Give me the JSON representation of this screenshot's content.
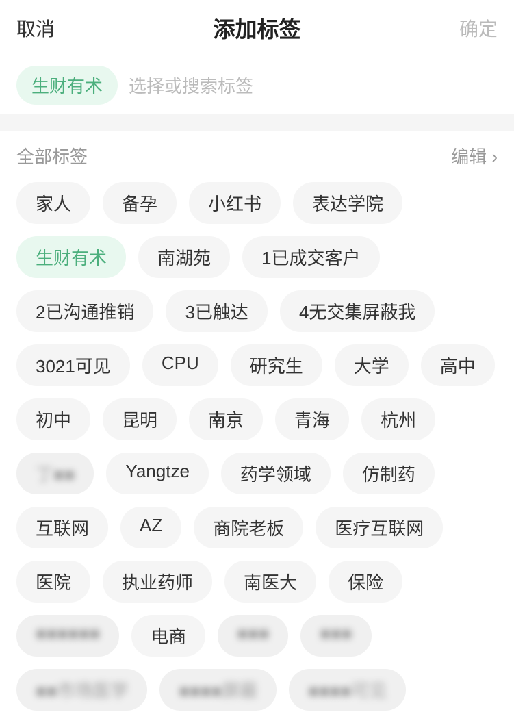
{
  "header": {
    "cancel_label": "取消",
    "title": "添加标签",
    "confirm_label": "确定"
  },
  "search_bar": {
    "selected_tag": "生财有术",
    "placeholder": "选择或搜索标签"
  },
  "all_tags_section": {
    "title": "全部标签",
    "edit_label": "编辑 ›",
    "rows": [
      [
        {
          "text": "家人",
          "active": false,
          "blurred": false
        },
        {
          "text": "备孕",
          "active": false,
          "blurred": false
        },
        {
          "text": "小红书",
          "active": false,
          "blurred": false
        },
        {
          "text": "表达学院",
          "active": false,
          "blurred": false
        }
      ],
      [
        {
          "text": "生财有术",
          "active": true,
          "blurred": false
        },
        {
          "text": "南湖苑",
          "active": false,
          "blurred": false
        },
        {
          "text": "1已成交客户",
          "active": false,
          "blurred": false
        }
      ],
      [
        {
          "text": "2已沟通推销",
          "active": false,
          "blurred": false
        },
        {
          "text": "3已触达",
          "active": false,
          "blurred": false
        },
        {
          "text": "4无交集屏蔽我",
          "active": false,
          "blurred": false
        }
      ],
      [
        {
          "text": "3021可见",
          "active": false,
          "blurred": false
        },
        {
          "text": "CPU",
          "active": false,
          "blurred": false
        },
        {
          "text": "研究生",
          "active": false,
          "blurred": false
        },
        {
          "text": "大学",
          "active": false,
          "blurred": false
        },
        {
          "text": "高中",
          "active": false,
          "blurred": false
        }
      ],
      [
        {
          "text": "初中",
          "active": false,
          "blurred": false
        },
        {
          "text": "昆明",
          "active": false,
          "blurred": false
        },
        {
          "text": "南京",
          "active": false,
          "blurred": false
        },
        {
          "text": "青海",
          "active": false,
          "blurred": false
        },
        {
          "text": "杭州",
          "active": false,
          "blurred": false
        }
      ],
      [
        {
          "text": "丁■■",
          "active": false,
          "blurred": true
        },
        {
          "text": "Yangtze",
          "active": false,
          "blurred": false
        },
        {
          "text": "药学领域",
          "active": false,
          "blurred": false
        },
        {
          "text": "仿制药",
          "active": false,
          "blurred": false
        }
      ],
      [
        {
          "text": "互联网",
          "active": false,
          "blurred": false
        },
        {
          "text": "AZ",
          "active": false,
          "blurred": false
        },
        {
          "text": "商院老板",
          "active": false,
          "blurred": false
        },
        {
          "text": "医疗互联网",
          "active": false,
          "blurred": false
        }
      ],
      [
        {
          "text": "医院",
          "active": false,
          "blurred": false
        },
        {
          "text": "执业药师",
          "active": false,
          "blurred": false
        },
        {
          "text": "南医大",
          "active": false,
          "blurred": false
        },
        {
          "text": "保险",
          "active": false,
          "blurred": false
        }
      ],
      [
        {
          "text": "■■■■■■",
          "active": false,
          "blurred": true
        },
        {
          "text": "电商",
          "active": false,
          "blurred": false
        },
        {
          "text": "■■■",
          "active": false,
          "blurred": true
        },
        {
          "text": "■■■",
          "active": false,
          "blurred": true
        }
      ],
      [
        {
          "text": "■■市场医学",
          "active": false,
          "blurred": true
        },
        {
          "text": "■■■■屏蔽",
          "active": false,
          "blurred": true
        },
        {
          "text": "■■■■可见",
          "active": false,
          "blurred": true
        }
      ]
    ]
  }
}
